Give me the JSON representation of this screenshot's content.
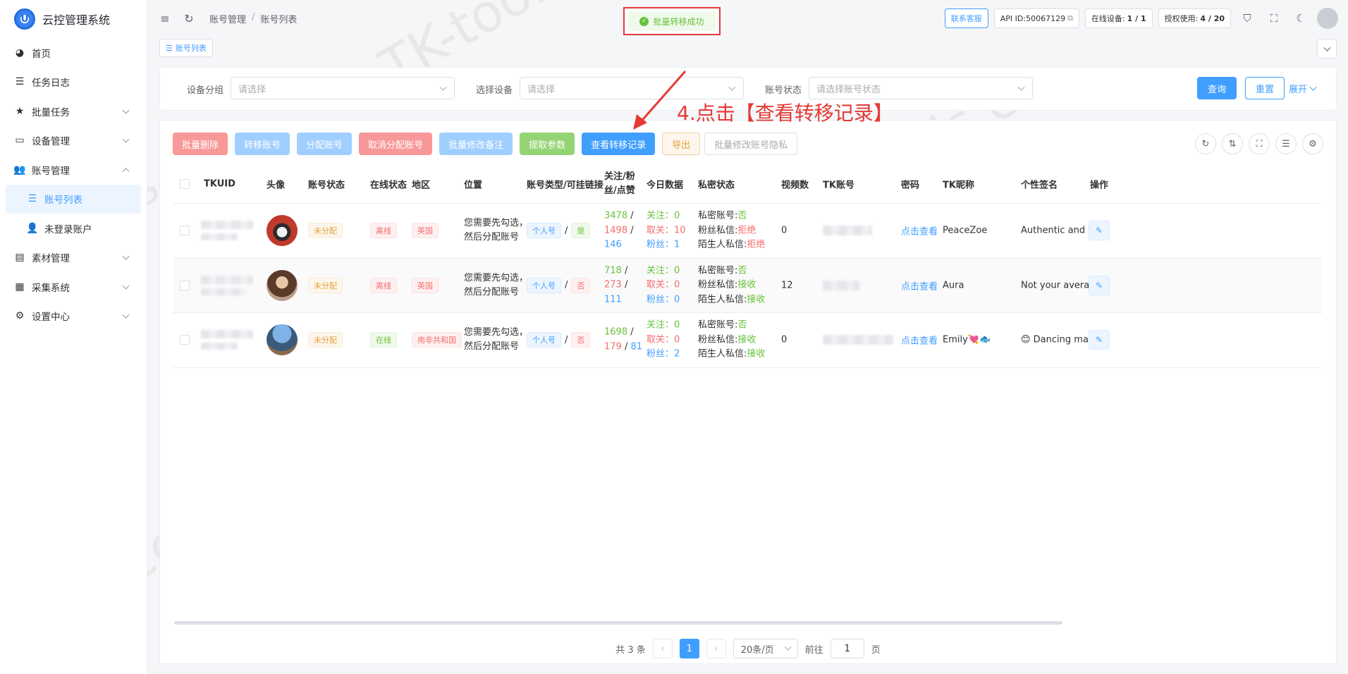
{
  "app": {
    "title": "云控管理系统",
    "logo_letter": "U"
  },
  "sidebar": {
    "items": [
      {
        "label": "首页",
        "icon": "dashboard-icon"
      },
      {
        "label": "任务日志",
        "icon": "list-icon"
      },
      {
        "label": "批量任务",
        "icon": "star-icon"
      },
      {
        "label": "设备管理",
        "icon": "monitor-icon"
      },
      {
        "label": "账号管理",
        "icon": "users-icon"
      },
      {
        "label": "账号列表",
        "icon": "list-icon"
      },
      {
        "label": "未登录账户",
        "icon": "user-icon"
      },
      {
        "label": "素材管理",
        "icon": "document-icon"
      },
      {
        "label": "采集系统",
        "icon": "archive-icon"
      },
      {
        "label": "设置中心",
        "icon": "gear-icon"
      }
    ]
  },
  "header": {
    "breadcrumb": [
      "账号管理",
      "账号列表"
    ],
    "contact": "联系客服",
    "api_id": "API ID:50067129",
    "online_label": "在线设备:",
    "online_value": "1 / 1",
    "license_label": "授权使用:",
    "license_value": "4 / 20"
  },
  "toast": {
    "message": "批量转移成功"
  },
  "tagbar": {
    "tab": "账号列表"
  },
  "filters": {
    "group_label": "设备分组",
    "group_placeholder": "请选择",
    "device_label": "选择设备",
    "device_placeholder": "请选择",
    "status_label": "账号状态",
    "status_placeholder": "请选择账号状态",
    "query": "查询",
    "reset": "重置",
    "expand": "展开"
  },
  "toolbar": {
    "batch_delete": "批量删除",
    "transfer": "转移账号",
    "assign": "分配账号",
    "unassign": "取消分配账号",
    "batch_note": "批量修改备注",
    "extract": "提取参数",
    "view_transfer": "查看转移记录",
    "export": "导出",
    "batch_privacy": "批量修改账号隐私"
  },
  "annotation": "4.点击【查看转移记录】",
  "table": {
    "headers": [
      "TKUID",
      "头像",
      "账号状态",
      "在线状态",
      "地区",
      "位置",
      "账号类型/可挂链接",
      "关注/粉丝/点赞",
      "今日数据",
      "私密状态",
      "视频数",
      "TK账号",
      "密码",
      "TK昵称",
      "个性签名",
      "操作"
    ],
    "rows": [
      {
        "status": "未分配",
        "online": "离线",
        "online_type": "danger",
        "region": "英国",
        "position": "您需要先勾选，然后分配账号",
        "acct_type": "个人号",
        "link": "是",
        "link_type": "success",
        "follow": "3478",
        "fans": "1498",
        "likes": "146",
        "today_follow": "关注：0",
        "today_unfollow": "取关：10",
        "today_fans": "粉丝：1",
        "private_acct": "私密账号:",
        "private_acct_v": "否",
        "fans_msg": "粉丝私信:",
        "fans_msg_v": "拒绝",
        "stranger_msg": "陌生人私信:",
        "stranger_msg_v": "拒绝",
        "videos": "0",
        "password": "点击查看",
        "nickname": "PeaceZoe",
        "signature": "Authentic and to..."
      },
      {
        "status": "未分配",
        "online": "离线",
        "online_type": "danger",
        "region": "英国",
        "position": "您需要先勾选，然后分配账号",
        "acct_type": "个人号",
        "link": "否",
        "link_type": "danger",
        "follow": "718",
        "fans": "273",
        "likes": "111",
        "today_follow": "关注：0",
        "today_unfollow": "取关：0",
        "today_fans": "粉丝：0",
        "private_acct": "私密账号:",
        "private_acct_v": "否",
        "fans_msg": "粉丝私信:",
        "fans_msg_v": "接收",
        "stranger_msg": "陌生人私信:",
        "stranger_msg_v": "接收",
        "videos": "12",
        "password": "点击查看",
        "nickname": "Aura",
        "signature": "Not your average..."
      },
      {
        "status": "未分配",
        "online": "在线",
        "online_type": "success",
        "region": "南非共和国",
        "position": "您需要先勾选，然后分配账号",
        "acct_type": "个人号",
        "link": "否",
        "link_type": "danger",
        "follow": "1698",
        "fans": "179",
        "likes": "81",
        "today_follow": "关注：0",
        "today_unfollow": "取关：0",
        "today_fans": "粉丝：2",
        "private_acct": "私密账号:",
        "private_acct_v": "否",
        "fans_msg": "粉丝私信:",
        "fans_msg_v": "接收",
        "stranger_msg": "陌生人私信:",
        "stranger_msg_v": "接收",
        "videos": "0",
        "password": "点击查看",
        "nickname": "Emily💘🐟",
        "signature": "😊 Dancing mak..."
      }
    ]
  },
  "pagination": {
    "total": "共 3 条",
    "page": "1",
    "size": "20条/页",
    "goto": "前往",
    "goto_value": "1",
    "page_unit": "页"
  },
  "watermark": "TK-tools.cc",
  "colors": {
    "primary": "#409eff",
    "success": "#67c23a",
    "danger": "#f56c6c",
    "warning": "#e6a23c",
    "annotation": "#e53935"
  }
}
